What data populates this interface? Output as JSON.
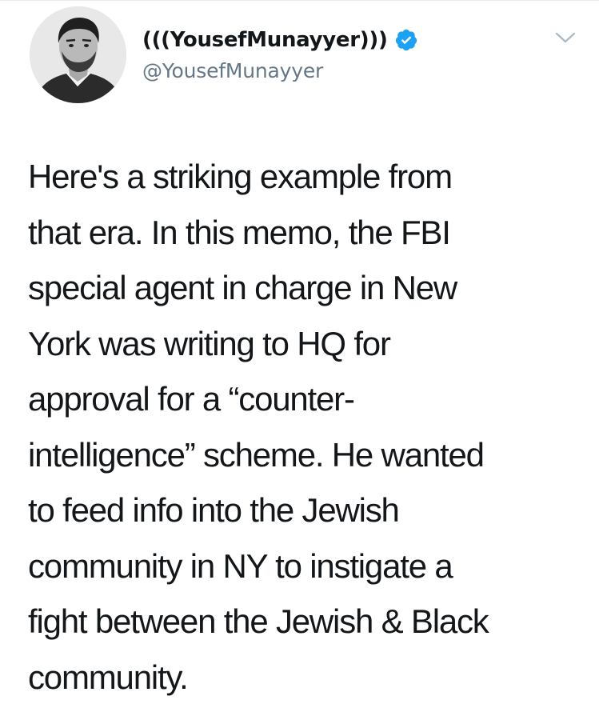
{
  "tweet": {
    "author": {
      "display_name": "(((YousefMunayyer)))",
      "handle": "@YousefMunayyer",
      "verified": true,
      "verified_color": "#1da1f2"
    },
    "caret_icon": "chevron-down-icon",
    "text_lines": [
      "Here's a striking example from",
      "that era. In this memo, the FBI",
      "special agent in charge in New",
      "York was writing to HQ for",
      "approval for a “counter-",
      "intelligence” scheme. He wanted",
      "to feed info into the Jewish",
      "community in NY to instigate a",
      "fight between the Jewish & Black",
      "community."
    ]
  },
  "colors": {
    "text": "#14171a",
    "secondary": "#657786",
    "accent": "#1da1f2",
    "divider": "#e6ecf0"
  }
}
